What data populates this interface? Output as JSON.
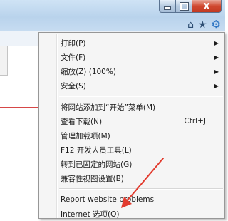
{
  "window": {
    "caption": {
      "min": "minimize",
      "max": "maximize",
      "close_label": "X"
    },
    "toolbar_icons": [
      {
        "name": "home-icon",
        "glyph": "⌂"
      },
      {
        "name": "favorites-star-icon",
        "glyph": "★"
      },
      {
        "name": "gear-icon",
        "glyph": "⚙"
      }
    ]
  },
  "menu": {
    "group1": [
      {
        "label": "打印(P)",
        "submenu": true
      },
      {
        "label": "文件(F)",
        "submenu": true
      },
      {
        "label": "缩放(Z) (100%)",
        "submenu": true
      },
      {
        "label": "安全(S)",
        "submenu": true
      }
    ],
    "group2": [
      {
        "label": "将网站添加到“开始”菜单(M)"
      },
      {
        "label": "查看下载(N)",
        "shortcut": "Ctrl+J"
      },
      {
        "label": "管理加载项(M)"
      },
      {
        "label": "F12 开发人员工具(L)"
      },
      {
        "label": "转到已固定的网站(G)"
      },
      {
        "label": "兼容性视图设置(B)"
      }
    ],
    "group3": [
      {
        "label": "Report website problems"
      },
      {
        "label": "Internet 选项(O)"
      }
    ],
    "arrow_glyph": "▶"
  },
  "colors": {
    "annotation": "#e23b2e",
    "gear": "#2a73c2"
  }
}
